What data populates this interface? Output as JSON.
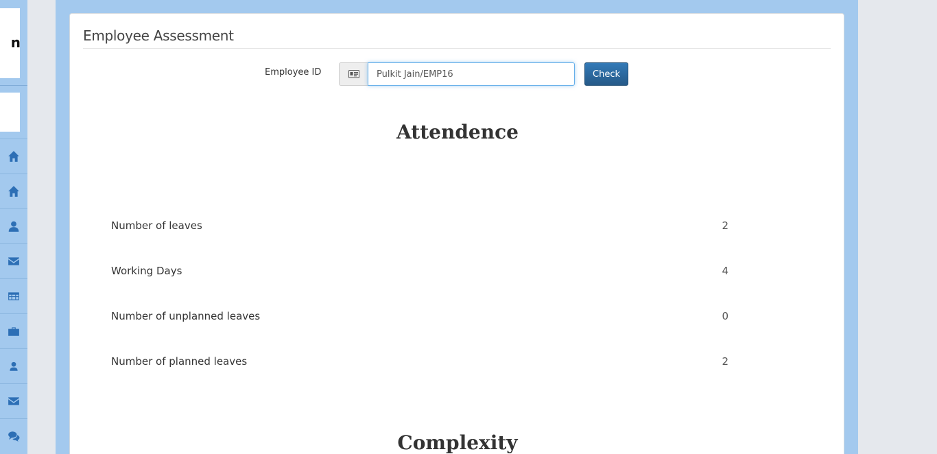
{
  "sidebar": {
    "logo_text": "n",
    "items": [
      {
        "icon": "home-icon"
      },
      {
        "icon": "home-icon"
      },
      {
        "icon": "user-icon"
      },
      {
        "icon": "envelope-icon"
      },
      {
        "icon": "table-icon"
      },
      {
        "icon": "briefcase-icon"
      },
      {
        "icon": "user-icon"
      },
      {
        "icon": "envelope-icon"
      },
      {
        "icon": "comments-icon"
      }
    ]
  },
  "panel": {
    "title": "Employee Assessment"
  },
  "form": {
    "employee_id_label": "Employee ID",
    "employee_id_value": "Pulkit Jain/EMP16",
    "check_label": "Check",
    "addon_icon": "id-card-icon"
  },
  "attendance": {
    "heading": "Attendence",
    "rows": [
      {
        "label": "Number of leaves",
        "value": "2"
      },
      {
        "label": "Working Days",
        "value": "4"
      },
      {
        "label": "Number of unplanned leaves",
        "value": "0"
      },
      {
        "label": "Number of planned leaves",
        "value": "2"
      }
    ]
  },
  "complexity": {
    "heading": "Complexity"
  },
  "colors": {
    "frame": "#a3c9ee",
    "sidebar_icon": "#2d6fb5",
    "button": "#2e6da4",
    "input_focus": "#66afe9"
  }
}
